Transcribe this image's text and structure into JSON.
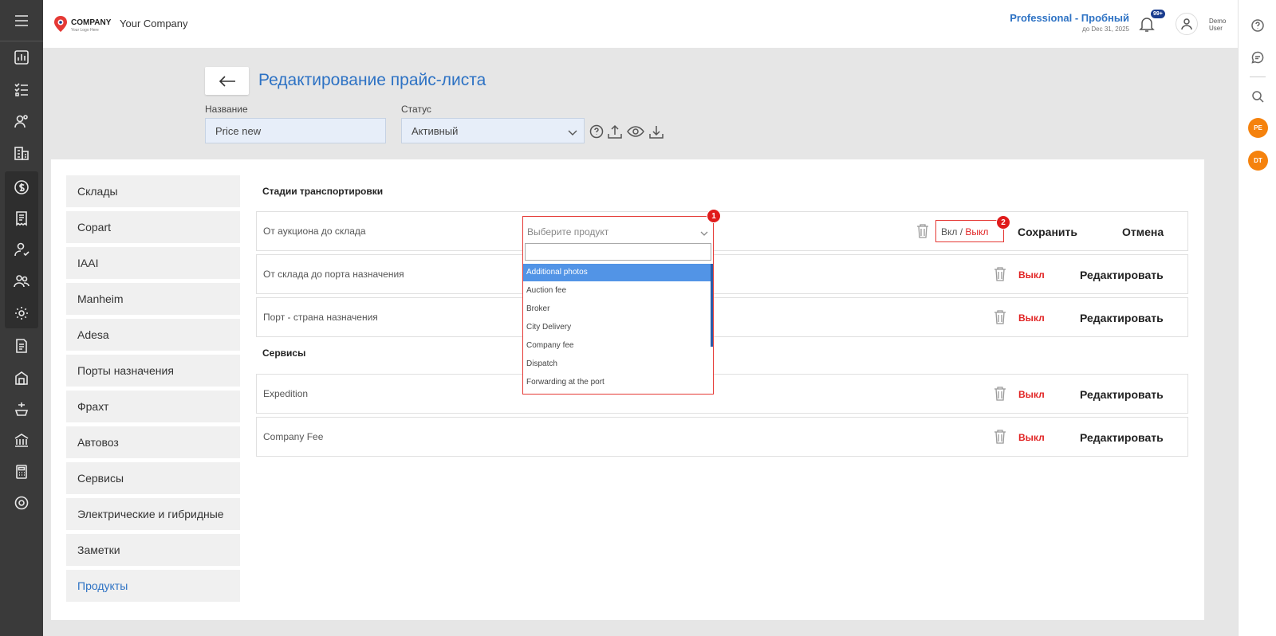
{
  "header": {
    "logo_text": "COMPANY",
    "logo_subtext": "Your Logo Here",
    "company_name": "Your Company",
    "plan": "Professional - Пробный",
    "plan_until": "до Dec 31, 2025",
    "notifications_badge": "99+",
    "user_line1": "Demo",
    "user_line2": "User"
  },
  "page": {
    "title": "Редактирование прайс-листа",
    "name_label": "Название",
    "name_value": "Price new",
    "status_label": "Статус",
    "status_value": "Активный"
  },
  "sidebar": {
    "items": [
      "Склады",
      "Copart",
      "IAAI",
      "Manheim",
      "Adesa",
      "Порты назначения",
      "Фрахт",
      "Автовоз",
      "Сервисы",
      "Электрические и гибридные",
      "Заметки",
      "Продукты"
    ]
  },
  "sections": {
    "transport_title": "Стадии транспортировки",
    "services_title": "Сервисы"
  },
  "rows": {
    "row1_label": "От аукциона до склада",
    "row2_label": "От склада до порта назначения",
    "row3_label": "Порт - страна назначения",
    "row4_label": "Expedition",
    "row5_label": "Company Fee"
  },
  "actions": {
    "toggle_on": "Вкл /",
    "toggle_off": "Выкл",
    "off": "Выкл",
    "save": "Сохранить",
    "cancel": "Отмена",
    "edit": "Редактировать"
  },
  "dropdown": {
    "placeholder": "Выберите продукт",
    "options": [
      "Additional photos",
      "Auction fee",
      "Broker",
      "City Delivery",
      "Company fee",
      "Dispatch",
      "Forwarding at the port"
    ]
  },
  "annotations": {
    "marker1": "1",
    "marker2": "2"
  },
  "right_bar": {
    "avatar1": "PE",
    "avatar2": "DT"
  },
  "colors": {
    "accent": "#2d72c4",
    "danger": "#e12424",
    "selected": "#5294e6",
    "avatar": "#f5820d"
  }
}
